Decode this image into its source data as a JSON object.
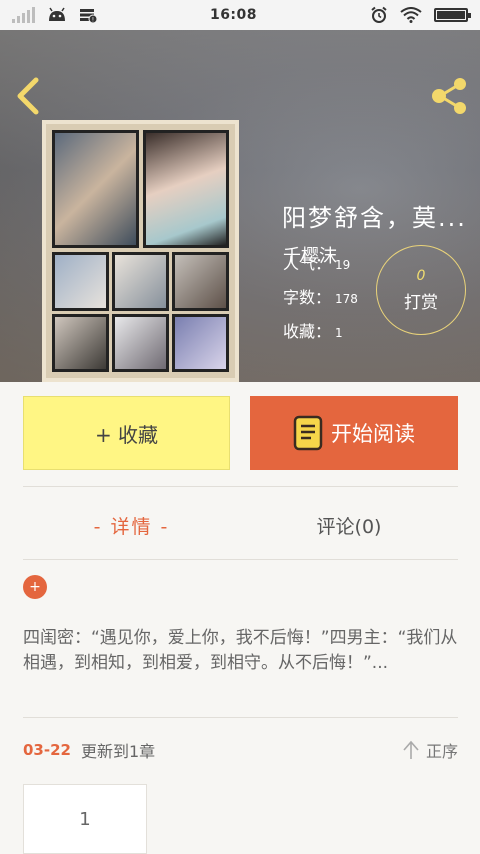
{
  "status_bar": {
    "time": "16:08"
  },
  "book": {
    "title": "阳梦舒含，莫...",
    "author": "千樱沫",
    "stats": [
      {
        "label": "人气：",
        "value": "19"
      },
      {
        "label": "字数：",
        "value": "178"
      },
      {
        "label": "收藏：",
        "value": "1"
      }
    ],
    "tip": {
      "count": "0",
      "label": "打赏"
    }
  },
  "actions": {
    "collect_label": "+ 收藏",
    "read_label": "开始阅读"
  },
  "tabs": {
    "details": "- 详情 -",
    "comments": "评论(0)"
  },
  "description": "四闺密：“遇见你，爱上你，我不后悔！”四男主：“我们从相遇，到相知，到相爱，到相守。从不后悔！”...",
  "update": {
    "date": "03-22",
    "text": "更新到1章",
    "order_label": "正序"
  },
  "chapters": [
    "1"
  ],
  "colors": {
    "accent": "#e4663e",
    "collect_bg": "#fff684",
    "tip_border": "#e9d37a"
  }
}
